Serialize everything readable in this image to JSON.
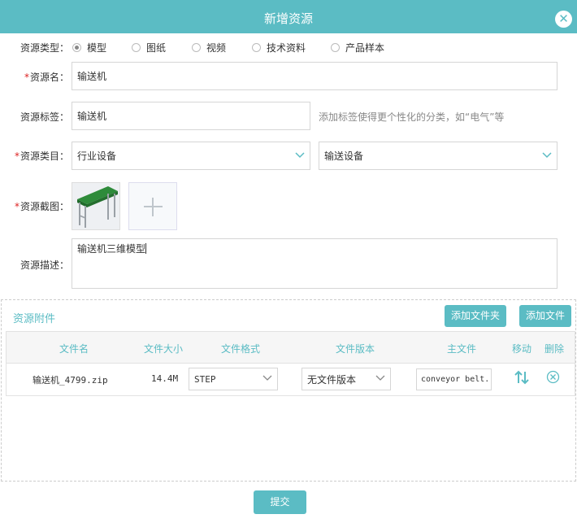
{
  "dialog": {
    "title": "新增资源",
    "close_icon": "close-icon"
  },
  "resource_type": {
    "label": "资源类型：",
    "options": [
      "模型",
      "图纸",
      "视频",
      "技术资料",
      "产品样本"
    ],
    "selected": "模型"
  },
  "resource_name": {
    "required_mark": "*",
    "label": "资源名：",
    "value": "输送机"
  },
  "resource_tag": {
    "label": "资源标签：",
    "value": "输送机",
    "hint": "添加标签使得更个性化的分类，如“电气”等"
  },
  "resource_category": {
    "required_mark": "*",
    "label": "资源类目：",
    "primary": "行业设备",
    "secondary": "输送设备"
  },
  "resource_screenshot": {
    "required_mark": "*",
    "label": "资源截图：",
    "add_icon": "plus-icon"
  },
  "resource_description": {
    "label": "资源描述：",
    "value": "输送机三维模型"
  },
  "attachments": {
    "title": "资源附件",
    "add_folder_label": "添加文件夹",
    "add_file_label": "添加文件",
    "headers": [
      "文件名",
      "文件大小",
      "文件格式",
      "文件版本",
      "主文件",
      "移动",
      "删除"
    ],
    "rows": [
      {
        "file_name": "输送机_4799.zip",
        "file_size": "14.4M",
        "file_format": "STEP",
        "file_version": "无文件版本",
        "main_file": "conveyor belt.",
        "move_icon": "move-arrows-icon",
        "delete_icon": "delete-circle-icon"
      }
    ]
  },
  "submit_label": "提交",
  "colors": {
    "accent": "#5bbcc4",
    "required": "#dd2222",
    "border": "#d6d6d6"
  }
}
